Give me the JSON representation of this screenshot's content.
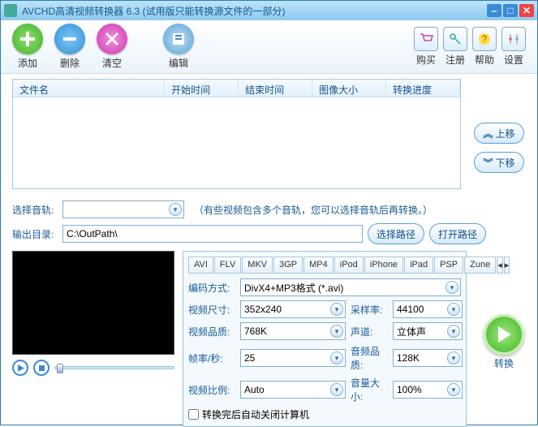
{
  "title": "AVCHD高清视频转换器 6.3 (试用版只能转换源文件的一部分)",
  "toolbar": {
    "add": "添加",
    "del": "删除",
    "clr": "清空",
    "edit": "编辑"
  },
  "rightbar": {
    "buy": "购买",
    "reg": "注册",
    "help": "帮助",
    "set": "设置"
  },
  "table": {
    "c1": "文件名",
    "c2": "开始时间",
    "c3": "结束时间",
    "c4": "图像大小",
    "c5": "转换进度"
  },
  "side": {
    "up": "上移",
    "down": "下移"
  },
  "audio": {
    "label": "选择音轨:",
    "note": "（有些视频包含多个音轨，您可以选择音轨后再转换。）"
  },
  "outdir": {
    "label": "输出目录:",
    "value": "C:\\OutPath\\",
    "browse": "选择路径",
    "open": "打开路径"
  },
  "tabs": [
    "AVI",
    "FLV",
    "MKV",
    "3GP",
    "MP4",
    "iPod",
    "iPhone",
    "iPad",
    "PSP",
    "Zune"
  ],
  "fields": {
    "encoder_l": "编码方式:",
    "encoder_v": "DivX4+MP3格式 (*.avi)",
    "size_l": "视频尺寸:",
    "size_v": "352x240",
    "srate_l": "采样率:",
    "srate_v": "44100",
    "vq_l": "视频品质:",
    "vq_v": "768K",
    "ch_l": "声道:",
    "ch_v": "立体声",
    "fps_l": "帧率/秒:",
    "fps_v": "25",
    "aq_l": "音频品质:",
    "aq_v": "128K",
    "ratio_l": "视频比例:",
    "ratio_v": "Auto",
    "vol_l": "音量大小:",
    "vol_v": "100%"
  },
  "shutdown": "转换完后自动关闭计算机",
  "convert": "转换"
}
